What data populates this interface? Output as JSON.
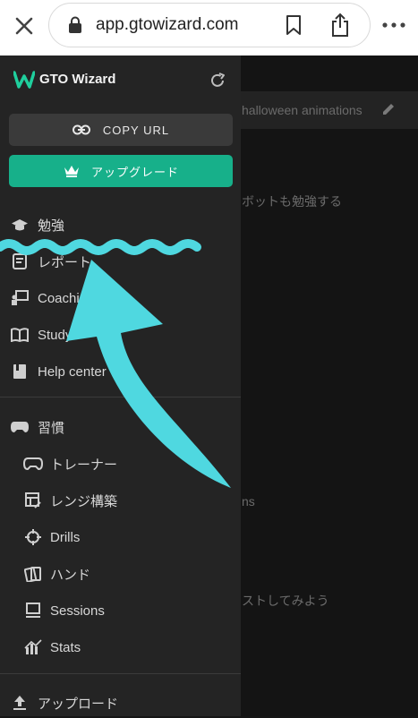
{
  "browser": {
    "url": "app.gtowizard.com",
    "icons": [
      "close-icon",
      "lock-icon",
      "bookmark-icon",
      "share-icon",
      "more-icon"
    ]
  },
  "background": {
    "top_strip_text": "halloween animations",
    "line1": "ボットも勉強する",
    "line2": "ns",
    "line3": "ストしてみよう"
  },
  "sidebar": {
    "logo": "GTO Wizard",
    "copy_url": "COPY URL",
    "upgrade": "アップグレード",
    "items": [
      {
        "label": "勉強",
        "icon": "graduation-cap-icon"
      },
      {
        "label": "レポート",
        "icon": "report-icon"
      },
      {
        "label": "Coaching",
        "icon": "coaching-icon"
      },
      {
        "label": "Study",
        "icon": "book-icon"
      },
      {
        "label": "Help center",
        "icon": "help-book-icon"
      }
    ],
    "practice": {
      "label": "習慣",
      "icon": "gamepad-icon",
      "children": [
        {
          "label": "トレーナー",
          "icon": "gamepad-icon"
        },
        {
          "label": "レンジ構築",
          "icon": "range-builder-icon"
        },
        {
          "label": "Drills",
          "icon": "crosshair-icon"
        },
        {
          "label": "ハンド",
          "icon": "cards-icon"
        },
        {
          "label": "Sessions",
          "icon": "monitor-icon"
        },
        {
          "label": "Stats",
          "icon": "stats-icon"
        }
      ]
    },
    "upload": {
      "label": "アップロード",
      "icon": "upload-icon"
    }
  },
  "colors": {
    "accent_green": "#17b08a",
    "annotation_cyan": "#4fd8e0",
    "sidebar_bg": "#242424"
  }
}
